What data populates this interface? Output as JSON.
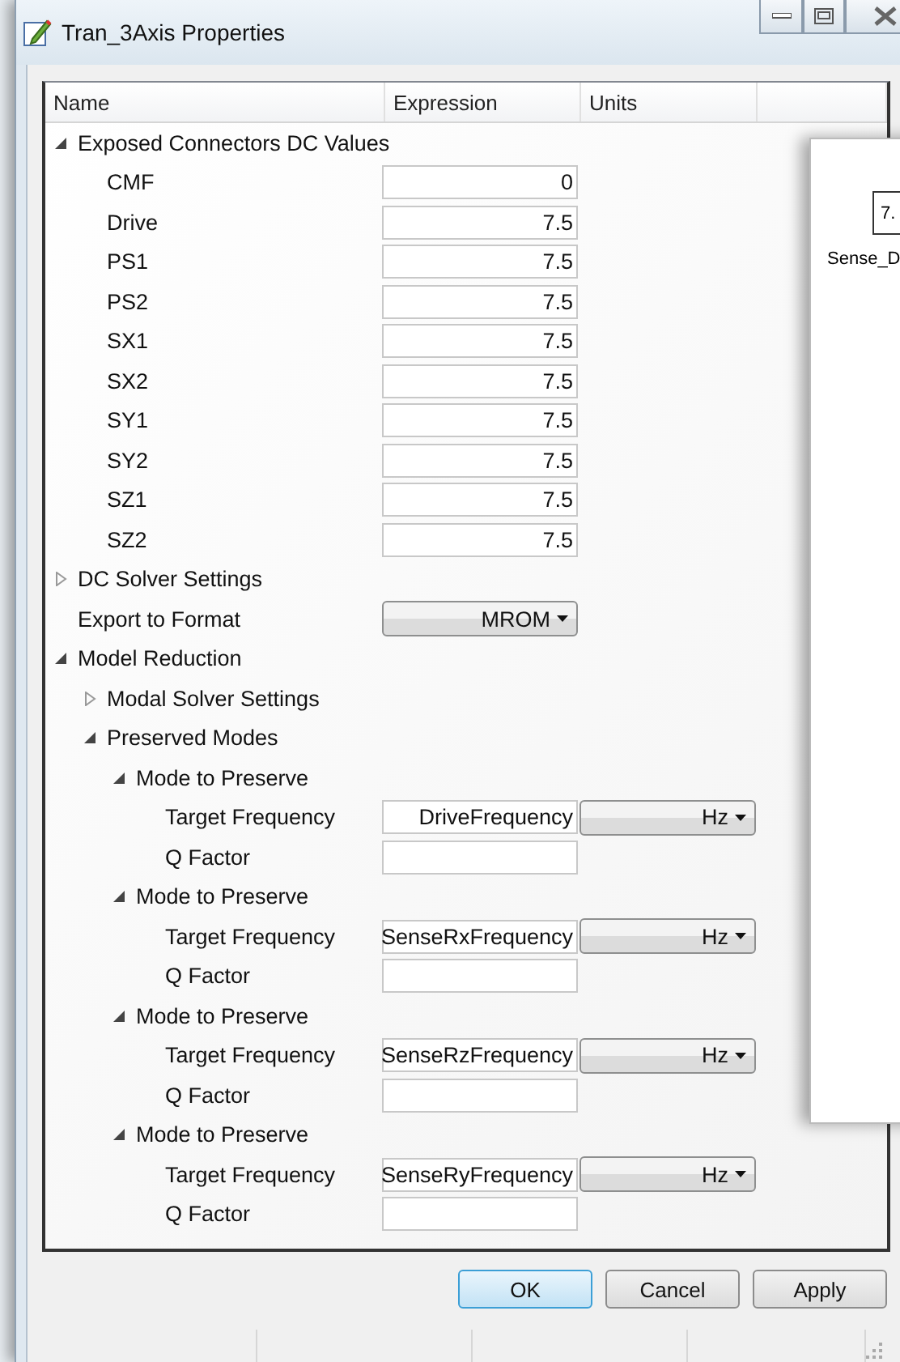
{
  "window": {
    "title": "Tran_3Axis Properties"
  },
  "table": {
    "columns": [
      "Name",
      "Expression",
      "Units"
    ],
    "rows": [
      {
        "label": "Exposed Connectors DC Values",
        "kind": "group",
        "expanded": true,
        "children": [
          {
            "label": "CMF",
            "kind": "value",
            "value": "0"
          },
          {
            "label": "Drive",
            "kind": "value",
            "value": "7.5"
          },
          {
            "label": "PS1",
            "kind": "value",
            "value": "7.5"
          },
          {
            "label": "PS2",
            "kind": "value",
            "value": "7.5"
          },
          {
            "label": "SX1",
            "kind": "value",
            "value": "7.5"
          },
          {
            "label": "SX2",
            "kind": "value",
            "value": "7.5"
          },
          {
            "label": "SY1",
            "kind": "value",
            "value": "7.5"
          },
          {
            "label": "SY2",
            "kind": "value",
            "value": "7.5"
          },
          {
            "label": "SZ1",
            "kind": "value",
            "value": "7.5"
          },
          {
            "label": "SZ2",
            "kind": "value",
            "value": "7.5"
          }
        ]
      },
      {
        "label": "DC Solver Settings",
        "kind": "group",
        "expanded": false
      },
      {
        "label": "Export to Format",
        "kind": "dropdown",
        "value": "MROM"
      },
      {
        "label": "Model Reduction",
        "kind": "group",
        "expanded": true,
        "children": [
          {
            "label": "Modal Solver Settings",
            "kind": "group",
            "expanded": false
          },
          {
            "label": "Preserved Modes",
            "kind": "group",
            "expanded": true,
            "children": [
              {
                "label": "Mode to Preserve",
                "kind": "group",
                "expanded": true,
                "children": [
                  {
                    "label": "Target Frequency",
                    "kind": "value",
                    "value": "DriveFrequency",
                    "unit": "Hz"
                  },
                  {
                    "label": "Q Factor",
                    "kind": "value"
                  }
                ]
              },
              {
                "label": "Mode to Preserve",
                "kind": "group",
                "expanded": true,
                "children": [
                  {
                    "label": "Target Frequency",
                    "kind": "value",
                    "value": "SenseRxFrequency",
                    "unit": "Hz"
                  },
                  {
                    "label": "Q Factor",
                    "kind": "value"
                  }
                ]
              },
              {
                "label": "Mode to Preserve",
                "kind": "group",
                "expanded": true,
                "children": [
                  {
                    "label": "Target Frequency",
                    "kind": "value",
                    "value": "SenseRzFrequency",
                    "unit": "Hz"
                  },
                  {
                    "label": "Q Factor",
                    "kind": "value"
                  }
                ]
              },
              {
                "label": "Mode to Preserve",
                "kind": "group",
                "expanded": true,
                "children": [
                  {
                    "label": "Target Frequency",
                    "kind": "value",
                    "value": "SenseRyFrequency",
                    "unit": "Hz"
                  },
                  {
                    "label": "Q Factor",
                    "kind": "value"
                  }
                ]
              }
            ]
          }
        ]
      }
    ]
  },
  "buttons": [
    {
      "label": "OK",
      "selected": true
    },
    {
      "label": "Cancel",
      "selected": false
    },
    {
      "label": "Apply",
      "selected": false
    }
  ],
  "background_window": {
    "block_value": "7.",
    "block_label": "Sense_D"
  }
}
